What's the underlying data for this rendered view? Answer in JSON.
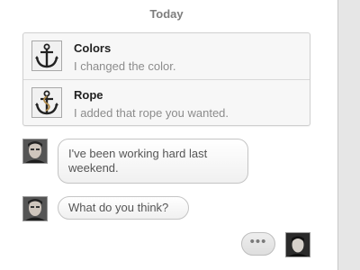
{
  "date_header": "Today",
  "updates": [
    {
      "title": "Colors",
      "text": "I changed the color.",
      "icon": "anchor-icon"
    },
    {
      "title": "Rope",
      "text": "I added that rope you wanted.",
      "icon": "anchor-rope-icon"
    }
  ],
  "messages": [
    {
      "text": "I've been working hard last weekend.",
      "sender": "contact"
    },
    {
      "text": "What do you think?",
      "sender": "contact"
    }
  ],
  "typing_indicator": "•••"
}
